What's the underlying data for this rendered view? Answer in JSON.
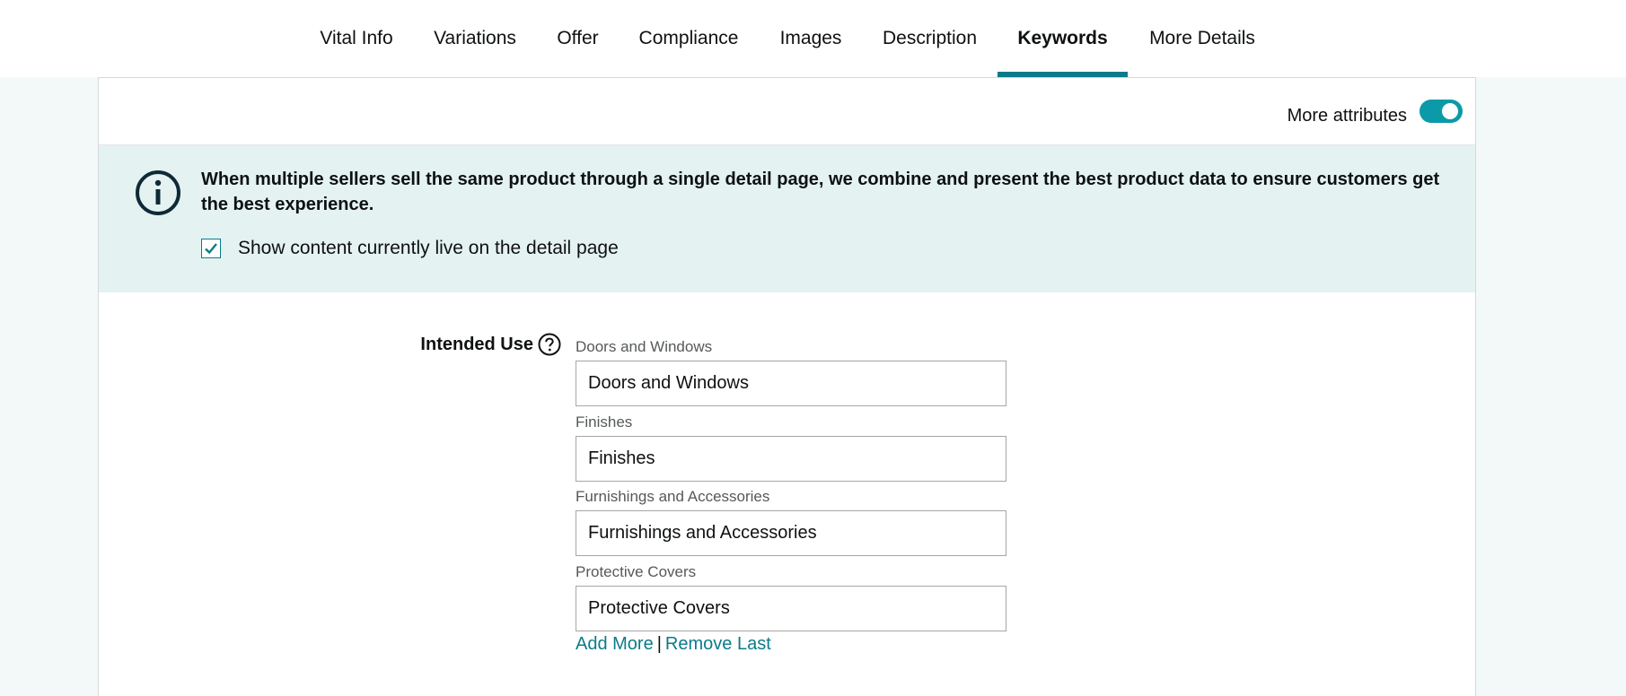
{
  "tabs": [
    {
      "label": "Vital Info",
      "active": false
    },
    {
      "label": "Variations",
      "active": false
    },
    {
      "label": "Offer",
      "active": false
    },
    {
      "label": "Compliance",
      "active": false
    },
    {
      "label": "Images",
      "active": false
    },
    {
      "label": "Description",
      "active": false
    },
    {
      "label": "Keywords",
      "active": true
    },
    {
      "label": "More Details",
      "active": false
    }
  ],
  "attributes": {
    "label": "More attributes",
    "toggle_on": true
  },
  "notice": {
    "icon": "info-icon",
    "text": "When multiple sellers sell the same product through a single detail page, we combine and present the best product data to ensure customers get the best experience.",
    "checkbox_label": "Show content currently live on the detail page",
    "checkbox_checked": true
  },
  "intended_use": {
    "label": "Intended Use",
    "help_icon": "question-circle-icon",
    "entries": [
      {
        "sublabel": "Doors and Windows",
        "value": "Doors and Windows"
      },
      {
        "sublabel": "Finishes",
        "value": "Finishes"
      },
      {
        "sublabel": "Furnishings and Accessories",
        "value": "Furnishings and Accessories"
      },
      {
        "sublabel": "Protective Covers",
        "value": "Protective Covers"
      }
    ],
    "add_more": "Add More",
    "separator": "|",
    "remove_last": "Remove Last"
  },
  "colors": {
    "accent": "#0b7b8b",
    "toggle": "#0b9aa8",
    "notice_bg": "#e4f2f2",
    "page_bg": "#f3f8f8"
  }
}
